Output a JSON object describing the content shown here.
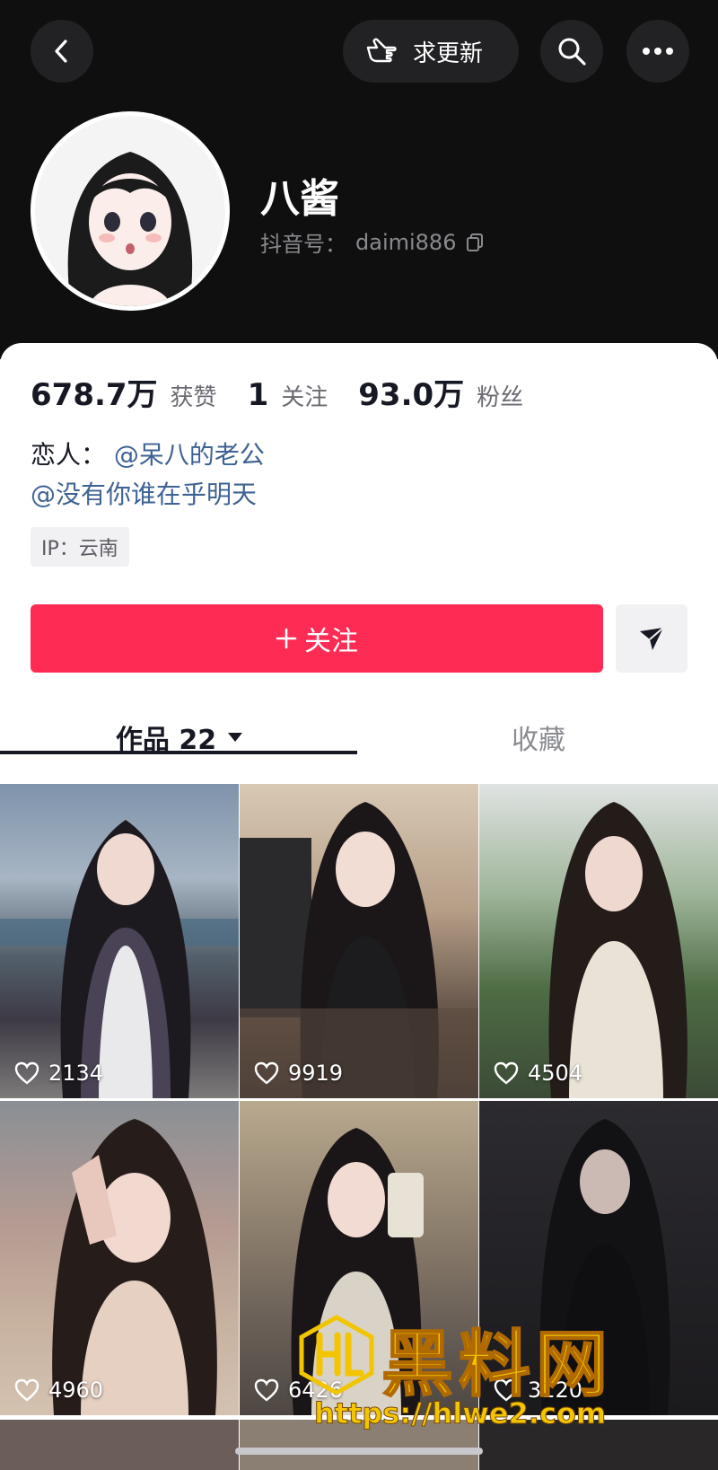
{
  "header": {
    "request_update_label": "求更新",
    "nickname": "八酱",
    "account_label": "抖音号：",
    "account_id": "daimi886"
  },
  "stats": {
    "likes_value": "678.7万",
    "likes_label": "获赞",
    "following_value": "1",
    "following_label": "关注",
    "followers_value": "93.0万",
    "followers_label": "粉丝"
  },
  "bio": {
    "lover_label": "恋人：",
    "lover_mention": "@呆八的老公",
    "line2_mention": "@没有你谁在乎明天"
  },
  "ip_tag": "IP：云南",
  "actions": {
    "follow_label": "关注"
  },
  "tabs": {
    "works_label": "作品 22",
    "favorites_label": "收藏"
  },
  "grid": [
    {
      "likes": "2134"
    },
    {
      "likes": "9919"
    },
    {
      "likes": "4504"
    },
    {
      "likes": "4960"
    },
    {
      "likes": "6426"
    },
    {
      "likes": "3120"
    }
  ],
  "watermark": {
    "title": "黑料网",
    "url": "https://hlwe2.com"
  },
  "colors": {
    "accent": "#fe2c55",
    "mention": "#3e6394",
    "header_bg": "#0f0f10",
    "watermark": "#f2c500"
  }
}
